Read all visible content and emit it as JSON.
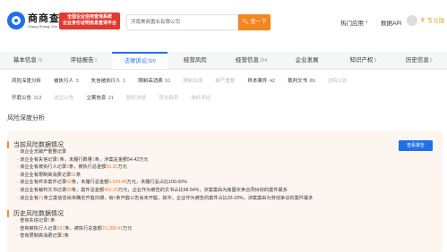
{
  "header": {
    "logo_cn": "商商查",
    "logo_en": "Shang Shang Cha",
    "promo_line1": "全国企业信用查询系统",
    "promo_line2": "企业身份证明信息查询平台",
    "search_value": "河南美商置业有限公司",
    "search_button": "查一下",
    "hot_apps": "热门应用",
    "data_api": "数据API",
    "vip_label": "专业版"
  },
  "tabs": [
    {
      "label": "基本信息",
      "count": "75"
    },
    {
      "label": "评估报告",
      "count": "1"
    },
    {
      "label": "法律诉讼",
      "count": "320"
    },
    {
      "label": "经营风险",
      "count": ""
    },
    {
      "label": "经营信息",
      "count": "264"
    },
    {
      "label": "企业发展",
      "count": ""
    },
    {
      "label": "知识产权",
      "count": "3"
    },
    {
      "label": "历史信息",
      "count": "2"
    }
  ],
  "filters_row1": [
    {
      "label": "风险深度分析",
      "count": "",
      "disabled": false
    },
    {
      "label": "被执行人",
      "count": "3",
      "disabled": false
    },
    {
      "label": "失信被执行人",
      "count": "1",
      "disabled": false
    },
    {
      "label": "限制高消费",
      "count": "51",
      "disabled": false
    },
    {
      "label": "限制出境",
      "count": "",
      "disabled": true
    },
    {
      "label": "破产重整",
      "count": "",
      "disabled": true
    },
    {
      "label": "终本案件",
      "count": "42",
      "disabled": false
    },
    {
      "label": "裁判文书",
      "count": "89",
      "disabled": false
    },
    {
      "label": "法院公告",
      "count": "",
      "disabled": true
    }
  ],
  "filters_row2": [
    {
      "label": "开庭公告",
      "count": "113",
      "disabled": false
    },
    {
      "label": "送达公告",
      "count": "",
      "disabled": true
    },
    {
      "label": "立案信息",
      "count": "21",
      "disabled": false
    },
    {
      "label": "股权冻结",
      "count": "",
      "disabled": true
    },
    {
      "label": "司法拍卖",
      "count": "",
      "disabled": true
    },
    {
      "label": "询价评估",
      "count": "",
      "disabled": true
    }
  ],
  "section_title": "风险深度分析",
  "current": {
    "heading": "当前风险数据情况",
    "report_button": "查看报告",
    "lines": [
      {
        "pre": "· 该企业无破产重整记录",
        "hl": "",
        "post": "",
        "hl2": "",
        "post2": ""
      },
      {
        "pre": "· 该企业有失信记录",
        "hl": "1",
        "post": "条，未履行数量",
        "hl2": "1",
        "post2": "条，涉案总金额54.42万元"
      },
      {
        "pre": "· 该企业有被执行人记录",
        "hl": "3",
        "post": "条，被执行总金额",
        "hl2": "55.31",
        "post2": "万元"
      },
      {
        "pre": "· 该企业有限制高消费记录",
        "hl": "51",
        "post": "条",
        "hl2": "",
        "post2": ""
      },
      {
        "pre": "· 该企业有终本案件记录",
        "hl": "42",
        "post": "条，未履行总金额",
        "hl2": "5,599.49",
        "post2": "万元，未履行总占比100.00%"
      },
      {
        "pre": "· 该企业有裁判文书记录",
        "hl": "89",
        "post": "条，案件总金额",
        "hl2": "401.23",
        "post2": "万元，企业作为被告的文书占比68.54%，涉案案由为房屋买卖合同纠纷的案件最多"
      },
      {
        "pre": "· 该企业有",
        "hl": "21",
        "post": "条立案信息尚未确定开庭日期，有",
        "hl2": "9",
        "post2": "条开庭公告尚未开庭，其中，企业作为被告的案件占比33.33%，涉案案由为劳动争议的案件最多"
      }
    ]
  },
  "history": {
    "heading": "历史风险数据情况",
    "lines": [
      {
        "pre": "· 曾有失信记录",
        "hl": "1",
        "post": "条",
        "hl2": "",
        "post2": ""
      },
      {
        "pre": "· 曾有被执行人记录",
        "hl": "167",
        "post": "条，被执行总金额",
        "hl2": "31,289.41",
        "post2": "万元"
      },
      {
        "pre": "· 曾有限制高消费记录",
        "hl": "3",
        "post": "条",
        "hl2": "",
        "post2": ""
      }
    ]
  },
  "colors": {
    "brand_blue": "#1f6fe8",
    "accent_orange": "#f5851f",
    "promo_red": "#e23a2e",
    "panel_bg": "#fdf6f0"
  }
}
